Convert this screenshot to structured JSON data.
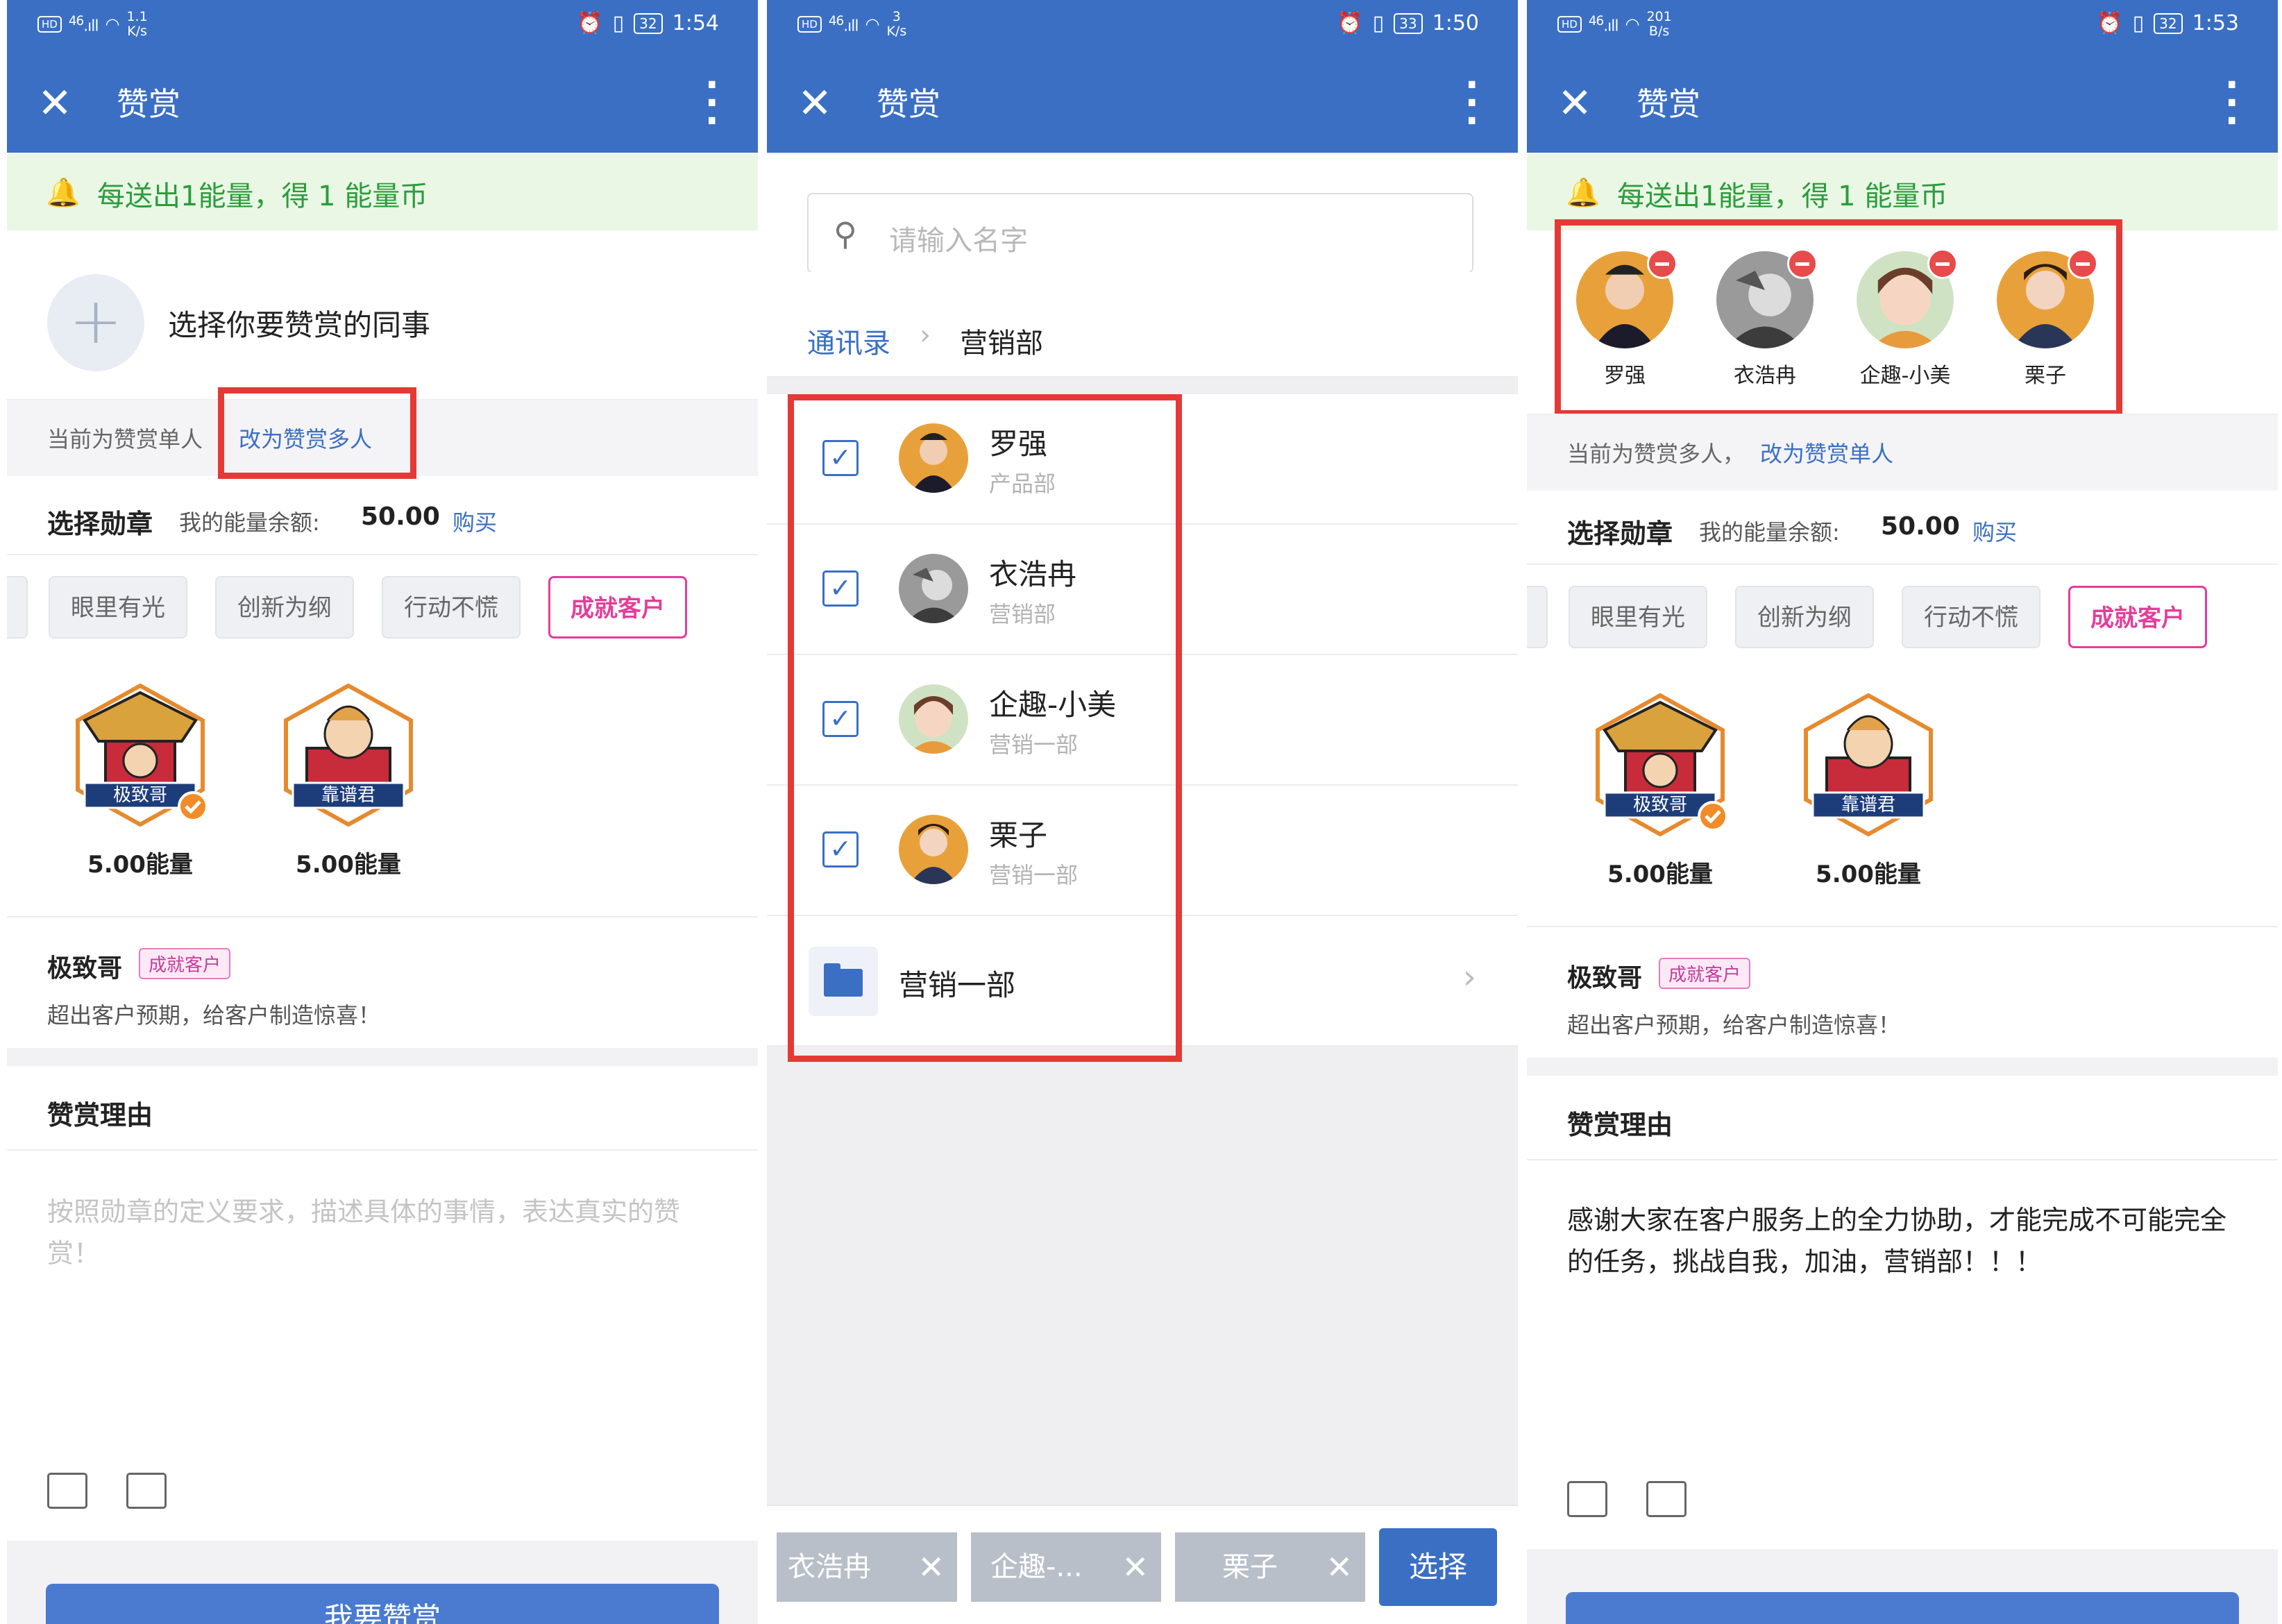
{
  "status_bars": [
    {
      "hd": "HD",
      "net": "46",
      "speed_val": "1.1",
      "speed_unit": "K/s",
      "battery": "32",
      "time": "1:54"
    },
    {
      "hd": "HD",
      "net": "46",
      "speed_val": "3",
      "speed_unit": "K/s",
      "battery": "33",
      "time": "1:50"
    },
    {
      "hd": "HD",
      "net": "46",
      "speed_val": "201",
      "speed_unit": "B/s",
      "battery": "32",
      "time": "1:53"
    }
  ],
  "app": {
    "title": "赞赏",
    "close_icon": "close-icon",
    "more_icon": "more-vertical-icon"
  },
  "notice": {
    "text": "每送出1能量，得 1 能量币",
    "icon": "bell-icon",
    "color": "#2a9d3b"
  },
  "panel1": {
    "picker_label": "选择你要赞赏的同事",
    "mode_static": "当前为赞赏单人",
    "mode_link": "改为赞赏多人",
    "submit": "我要赞赏"
  },
  "panel3": {
    "mode_static": "当前为赞赏多人，",
    "mode_link": "改为赞赏单人",
    "selected": [
      {
        "name": "罗强"
      },
      {
        "name": "衣浩冉"
      },
      {
        "name": "企趣-小美"
      },
      {
        "name": "栗子"
      }
    ],
    "reason_text": "感谢大家在客户服务上的全力协助，才能完成不可能完全的任务，挑战自我，加油，营销部！！！"
  },
  "medal": {
    "heading": "选择勋章",
    "balance_label": "我的能量余额:",
    "balance_value": "50.00",
    "buy": "购买",
    "tabs": [
      "眼里有光",
      "创新为纲",
      "行动不慌",
      "成就客户"
    ],
    "active_tab": "成就客户",
    "badges": [
      {
        "name": "极致哥",
        "energy": "5.00能量",
        "selected": true
      },
      {
        "name": "靠谱君",
        "energy": "5.00能量",
        "selected": false
      }
    ],
    "desc_name": "极致哥",
    "desc_tag": "成就客户",
    "desc_text": "超出客户预期，给客户制造惊喜！"
  },
  "reason": {
    "heading": "赞赏理由",
    "placeholder": "按照勋章的定义要求，描述具体的事情，表达真实的赞赏！"
  },
  "panel2": {
    "search_placeholder": "请输入名字",
    "crumb_root": "通讯录",
    "crumb_current": "营销部",
    "contacts": [
      {
        "name": "罗强",
        "dept": "产品部",
        "checked": true
      },
      {
        "name": "衣浩冉",
        "dept": "营销部",
        "checked": true
      },
      {
        "name": "企趣-小美",
        "dept": "营销一部",
        "checked": true
      },
      {
        "name": "栗子",
        "dept": "营销一部",
        "checked": true
      }
    ],
    "folder": "营销一部",
    "chips": [
      "衣浩冉",
      "企趣-...",
      "栗子"
    ],
    "select_button": "选择"
  },
  "colors": {
    "primary": "#3a6fc4",
    "accent": "#e43d9a",
    "highlight": "#e53935"
  }
}
